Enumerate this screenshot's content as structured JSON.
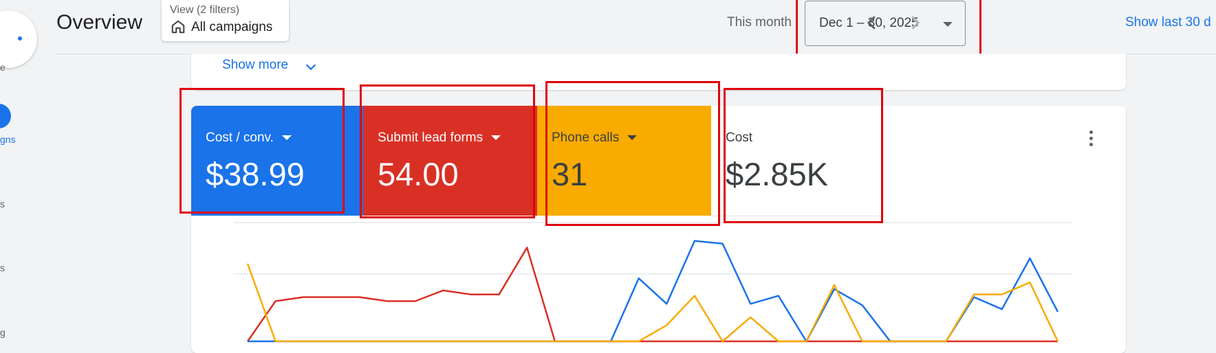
{
  "rail": {
    "items": [
      {
        "label": "e"
      },
      {
        "label": "gns"
      },
      {
        "label": "s"
      },
      {
        "label": "s"
      },
      {
        "label": "g"
      }
    ]
  },
  "header": {
    "title": "Overview",
    "view_label": "View (2 filters)",
    "view_value": "All campaigns",
    "period_label": "This month",
    "date_range": "Dec 1 – 30, 2025",
    "show_last": "Show last 30 d"
  },
  "prev_card": {
    "show_more": "Show more"
  },
  "metrics": [
    {
      "label": "Cost / conv.",
      "value": "$38.99",
      "color": "#1a73e8",
      "has_dropdown": true
    },
    {
      "label": "Submit lead forms",
      "value": "54.00",
      "color": "#d93025",
      "has_dropdown": true
    },
    {
      "label": "Phone calls",
      "value": "31",
      "color": "#f9ab00",
      "has_dropdown": true
    },
    {
      "label": "Cost",
      "value": "$2.85K",
      "color": "#ffffff",
      "has_dropdown": false
    }
  ],
  "icons": [
    "home-icon",
    "chevron-left-icon",
    "chevron-right-icon",
    "chevron-down-icon",
    "more-vert-icon",
    "caret-down-icon"
  ],
  "colors": {
    "accent": "#1a73e8",
    "red": "#d93025",
    "yellow": "#f9ab00",
    "highlight": "#e0000a"
  },
  "chart_data": {
    "type": "line",
    "x": [
      1,
      2,
      3,
      4,
      5,
      6,
      7,
      8,
      9,
      10,
      11,
      12,
      13,
      14,
      15,
      16,
      17,
      18,
      19,
      20,
      21,
      22,
      23,
      24,
      25,
      26,
      27,
      28,
      29,
      30
    ],
    "series": [
      {
        "color": "#d93025",
        "values": [
          0,
          30,
          33,
          33,
          33,
          30,
          30,
          38,
          35,
          35,
          70,
          0,
          0,
          0,
          0,
          0,
          0,
          0,
          0,
          0,
          0,
          0,
          0,
          0,
          0,
          0,
          0,
          0,
          0,
          0
        ]
      },
      {
        "color": "#1a73e8",
        "values": [
          0,
          0,
          0,
          0,
          0,
          0,
          0,
          0,
          0,
          0,
          0,
          0,
          0,
          0,
          47,
          28,
          75,
          73,
          28,
          34,
          0,
          39,
          27,
          0,
          0,
          0,
          33,
          24,
          62,
          22
        ]
      },
      {
        "color": "#f9ab00",
        "values": [
          58,
          0,
          0,
          0,
          0,
          0,
          0,
          0,
          0,
          0,
          0,
          0,
          0,
          0,
          0,
          12,
          34,
          0,
          18,
          0,
          0,
          42,
          0,
          0,
          0,
          0,
          35,
          35,
          44,
          0
        ]
      }
    ],
    "ylim": [
      0,
      80
    ],
    "grid": true,
    "legend": "tiles"
  }
}
